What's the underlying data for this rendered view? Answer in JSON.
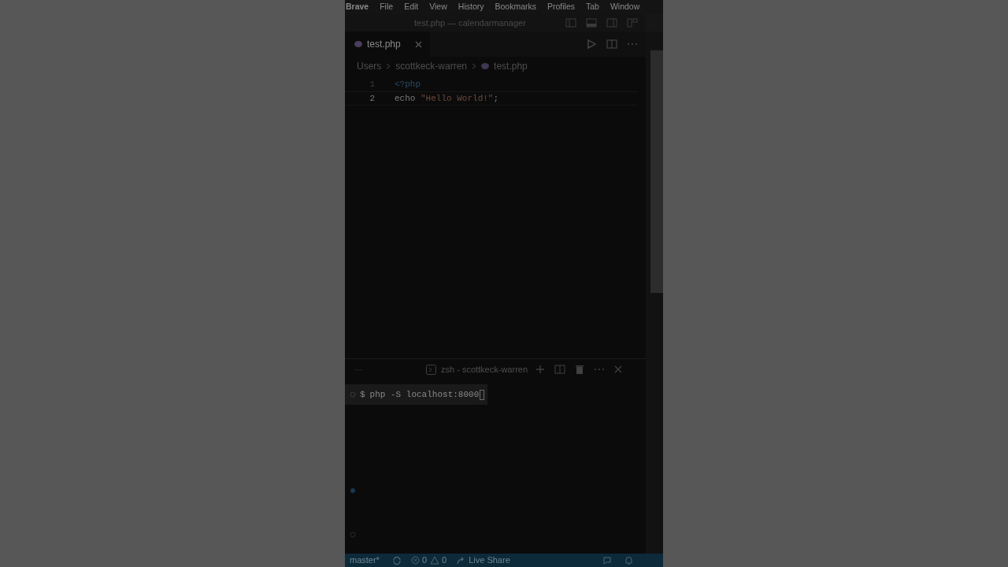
{
  "menu_bar": [
    "Brave",
    "File",
    "Edit",
    "View",
    "History",
    "Bookmarks",
    "Profiles",
    "Tab",
    "Window"
  ],
  "window": {
    "title": "test.php — calendarmanager"
  },
  "tabs": [
    {
      "label": "test.php",
      "selected": true
    }
  ],
  "breadcrumb": [
    "Users",
    "scottkeck-warren",
    "test.php"
  ],
  "editor": {
    "lines": [
      {
        "number": "1",
        "tokens": [
          {
            "kind": "tag",
            "text": "<?php"
          }
        ]
      },
      {
        "number": "2",
        "tokens": [
          {
            "kind": "keyword",
            "text": "echo "
          },
          {
            "kind": "string",
            "text": "\"Hello World!\""
          },
          {
            "kind": "plain",
            "text": ";"
          }
        ]
      }
    ]
  },
  "terminal": {
    "overflow_menu": "···",
    "tab": "zsh - scottkeck-warren",
    "prompt": "$",
    "command": "php -S localhost:8000"
  },
  "status_bar": {
    "branch": "master*",
    "errors": "0",
    "warnings": "0",
    "live_share": "Live Share"
  }
}
